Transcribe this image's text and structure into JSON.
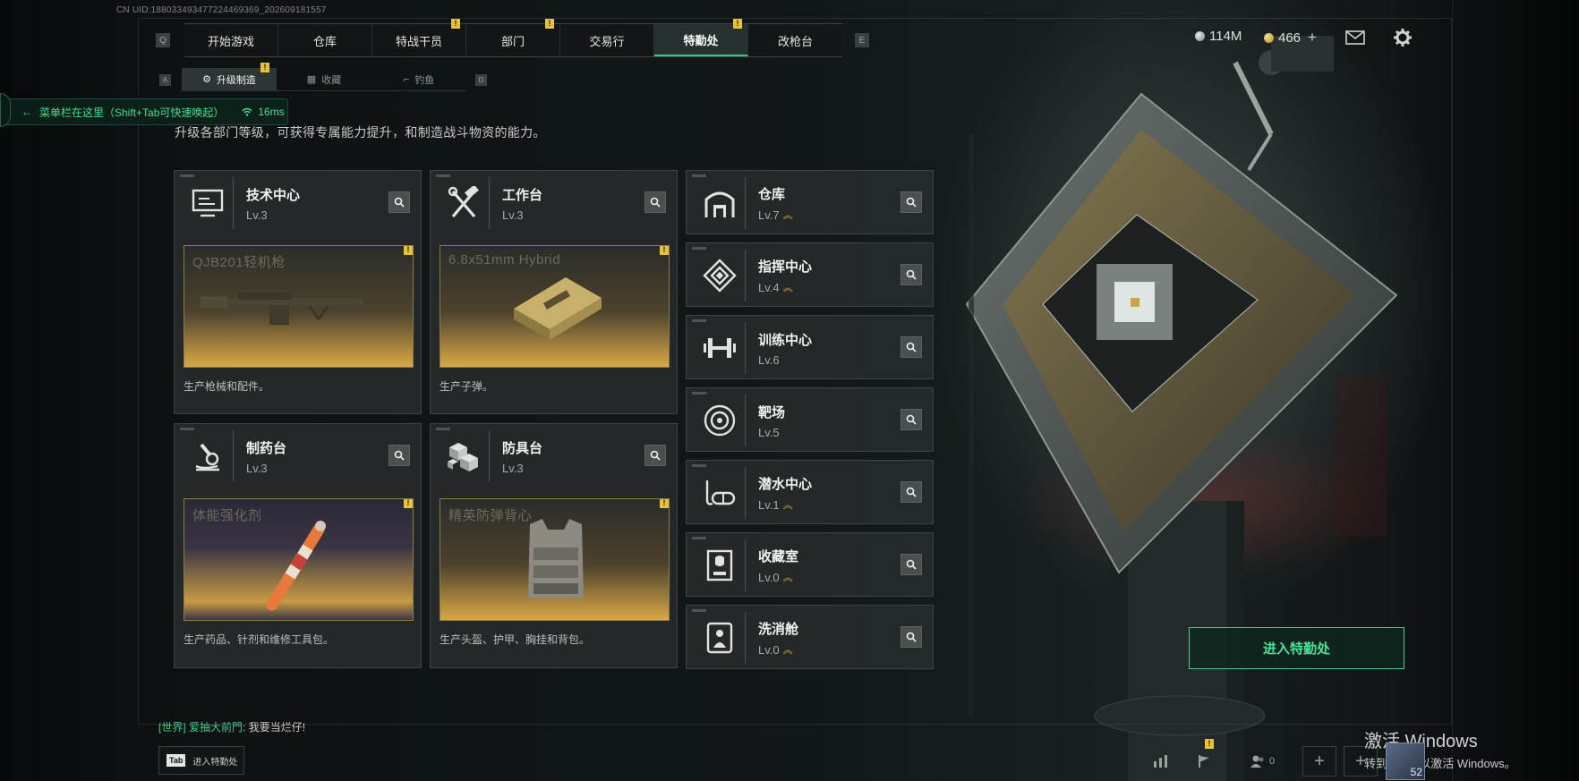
{
  "uid": "CN UID:1880334934772244693​69_202609181557",
  "top_nav": {
    "left_key": "Q",
    "right_key": "E",
    "tabs": [
      {
        "label": "开始游戏",
        "badge": "",
        "active": false
      },
      {
        "label": "仓库",
        "badge": "",
        "active": false
      },
      {
        "label": "特战干员",
        "badge": "!",
        "active": false
      },
      {
        "label": "部门",
        "badge": "!",
        "active": false
      },
      {
        "label": "交易行",
        "badge": "",
        "active": false
      },
      {
        "label": "特勤处",
        "badge": "!",
        "active": true
      },
      {
        "label": "改枪台",
        "badge": "",
        "active": false
      }
    ]
  },
  "currency": {
    "silver": "114M",
    "gold": "466",
    "plus": "+"
  },
  "sub_nav": {
    "left_key": "A",
    "right_key": "D",
    "tabs": [
      {
        "label": "升级制造",
        "active": true,
        "badge": "!"
      },
      {
        "label": "收藏",
        "active": false,
        "badge": ""
      },
      {
        "label": "钓鱼",
        "active": false,
        "badge": ""
      }
    ]
  },
  "menu_hint": {
    "arrow": "←",
    "text": "菜单栏在这里（Shift+Tab可快速唤起）",
    "ping": "16ms"
  },
  "description": "升级各部门等级，可获得专属能力提升，和制造战斗物资的能力。",
  "production_facilities": [
    {
      "name": "技术中心",
      "level": "Lv.3",
      "product": "QJB201轻机枪",
      "caption": "生产枪械和配件。",
      "badge": "!"
    },
    {
      "name": "工作台",
      "level": "Lv.3",
      "product": "6.8x51mm Hybrid",
      "caption": "生产子弹。",
      "badge": "!"
    },
    {
      "name": "制药台",
      "level": "Lv.3",
      "product": "体能强化剂",
      "caption": "生产药品、针剂和维修工具包。",
      "badge": "!"
    },
    {
      "name": "防具台",
      "level": "Lv.3",
      "product": "精英防弹背心",
      "caption": "生产头盔、护甲、胸挂和背包。",
      "badge": "!"
    }
  ],
  "facilities": [
    {
      "name": "仓库",
      "level": "Lv.7",
      "upgradable": true
    },
    {
      "name": "指挥中心",
      "level": "Lv.4",
      "upgradable": true
    },
    {
      "name": "训练中心",
      "level": "Lv.6",
      "upgradable": false
    },
    {
      "name": "靶场",
      "level": "Lv.5",
      "upgradable": false
    },
    {
      "name": "潜水中心",
      "level": "Lv.1",
      "upgradable": true
    },
    {
      "name": "收藏室",
      "level": "Lv.0",
      "upgradable": true
    },
    {
      "name": "洗消舱",
      "level": "Lv.0",
      "upgradable": true
    }
  ],
  "upgrade_glyph": "︽",
  "enter_button": "进入特勤处",
  "chat": {
    "channel": "[世界]",
    "sender": "爱抽大前門",
    "message": ": 我要当烂仔!"
  },
  "tab_hint": {
    "key": "Tab",
    "label": "进入特勤处"
  },
  "bottom_bar": {
    "friends_count": "0"
  },
  "watermark": {
    "title": "激活 Windows",
    "subtitle": "转到\"设置\"以激活 Windows。"
  },
  "avatar_level": "52",
  "colors": {
    "accent_green": "#37c98d",
    "badge_yellow": "#e8c33a",
    "upgrade_gold": "#e3b53a",
    "panel": "#262a2a"
  }
}
